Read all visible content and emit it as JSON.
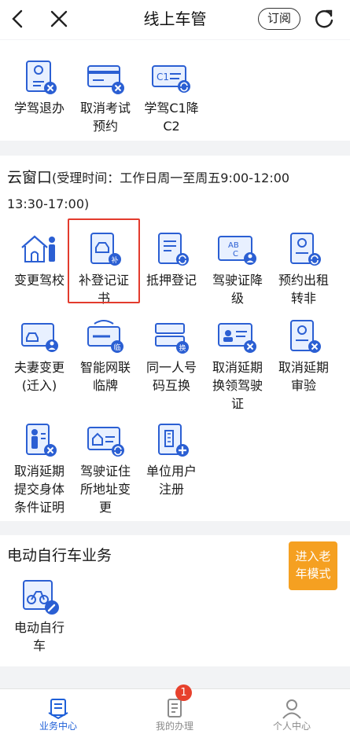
{
  "header": {
    "title": "线上车管",
    "subscribe_label": "订阅"
  },
  "section1": {
    "items": [
      {
        "label": "学驾退办"
      },
      {
        "label": "取消考试\n预约"
      },
      {
        "label": "学驾C1降\nC2"
      }
    ]
  },
  "cloud_window": {
    "title": "云窗口",
    "note": "(受理时间：工作日周一至周五9:00-12:00",
    "note2": "13:30-17:00)",
    "items": [
      {
        "label": "变更驾校"
      },
      {
        "label": "补登记证\n书"
      },
      {
        "label": "抵押登记"
      },
      {
        "label": "驾驶证降\n级"
      },
      {
        "label": "预约出租\n转非"
      },
      {
        "label": "夫妻变更\n(迁入)"
      },
      {
        "label": "智能网联\n临牌"
      },
      {
        "label": "同一人号\n码互换"
      },
      {
        "label": "取消延期\n换领驾驶\n证"
      },
      {
        "label": "取消延期\n审验"
      },
      {
        "label": "取消延期\n提交身体\n条件证明"
      },
      {
        "label": "驾驶证住\n所地址变\n更"
      },
      {
        "label": "单位用户\n注册"
      }
    ]
  },
  "ebike": {
    "title": "电动自行车业务",
    "items": [
      {
        "label": "电动自行\n车"
      }
    ],
    "elder_mode": "进入老\n年模式"
  },
  "tabbar": {
    "tabs": [
      {
        "label": "业务中心"
      },
      {
        "label": "我的办理"
      },
      {
        "label": "个人中心"
      }
    ],
    "badge": "1"
  },
  "colors": {
    "accent": "#1e5fd8",
    "highlight": "#e33b2d",
    "elder": "#f5a021",
    "badge": "#e7412d"
  }
}
